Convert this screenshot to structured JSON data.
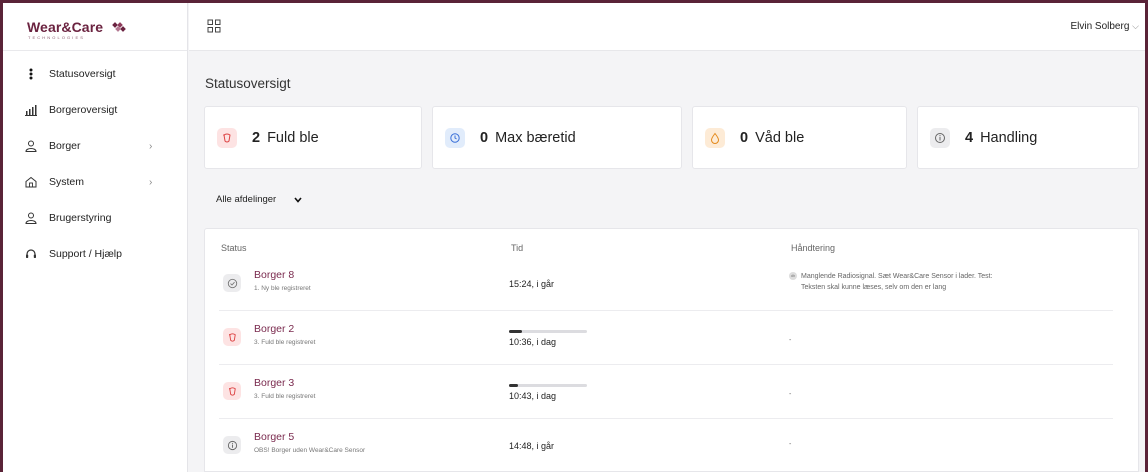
{
  "logo": {
    "name": "Wear&Care",
    "subtitle": "TECHNOLOGIES"
  },
  "sidebar": {
    "items": [
      {
        "label": "Statusoversigt",
        "icon": "vertical-dots-icon",
        "has_children": false
      },
      {
        "label": "Borgeroversigt",
        "icon": "bar-chart-icon",
        "has_children": false
      },
      {
        "label": "Borger",
        "icon": "person-icon",
        "has_children": true
      },
      {
        "label": "System",
        "icon": "house-icon",
        "has_children": true
      },
      {
        "label": "Brugerstyring",
        "icon": "person-icon",
        "has_children": false
      },
      {
        "label": "Support / Hjælp",
        "icon": "headset-icon",
        "has_children": false
      }
    ]
  },
  "topbar": {
    "user_name": "Elvin Solberg",
    "user_chevron": "⌵"
  },
  "main": {
    "title": "Statusoversigt",
    "cards": [
      {
        "count": "2",
        "label": "Fuld ble",
        "icon": "diaper-icon",
        "color": "#fde3e3"
      },
      {
        "count": "0",
        "label": "Max bæretid",
        "icon": "timer-icon",
        "color": "#e1ecfb"
      },
      {
        "count": "0",
        "label": "Våd ble",
        "icon": "drop-icon",
        "color": "#fdebd6"
      },
      {
        "count": "4",
        "label": "Handling",
        "icon": "info-icon",
        "color": "#ececee"
      }
    ],
    "filter": {
      "label": "Alle afdelinger"
    },
    "table": {
      "headers": {
        "status": "Status",
        "time": "Tid",
        "handling": "Håndtering"
      },
      "rows": [
        {
          "name": "Borger 8",
          "sub": "1. Ny ble registreret",
          "time": "15:24, i går",
          "progress": null,
          "handling_line1": "Manglende Radiosignal. Sæt Wear&Care Sensor i lader. Test:",
          "handling_line2": "Teksten skal kunne læses, selv om den er lang",
          "handling_icon": "dh"
        },
        {
          "name": "Borger 2",
          "sub": "3. Fuld ble registreret",
          "time": "10:36, i dag",
          "progress": 0.17,
          "handling_line1": "-"
        },
        {
          "name": "Borger 3",
          "sub": "3. Fuld ble registreret",
          "time": "10:43, i dag",
          "progress": 0.12,
          "handling_line1": "-"
        },
        {
          "name": "Borger 5",
          "sub": "OBS! Borger uden Wear&Care Sensor",
          "time": "14:48, i går",
          "progress": null,
          "handling_line1": "-"
        }
      ]
    }
  },
  "colors": {
    "brand": "#6b2340",
    "frame": "#5a2338",
    "link": "#7a2a4e"
  }
}
